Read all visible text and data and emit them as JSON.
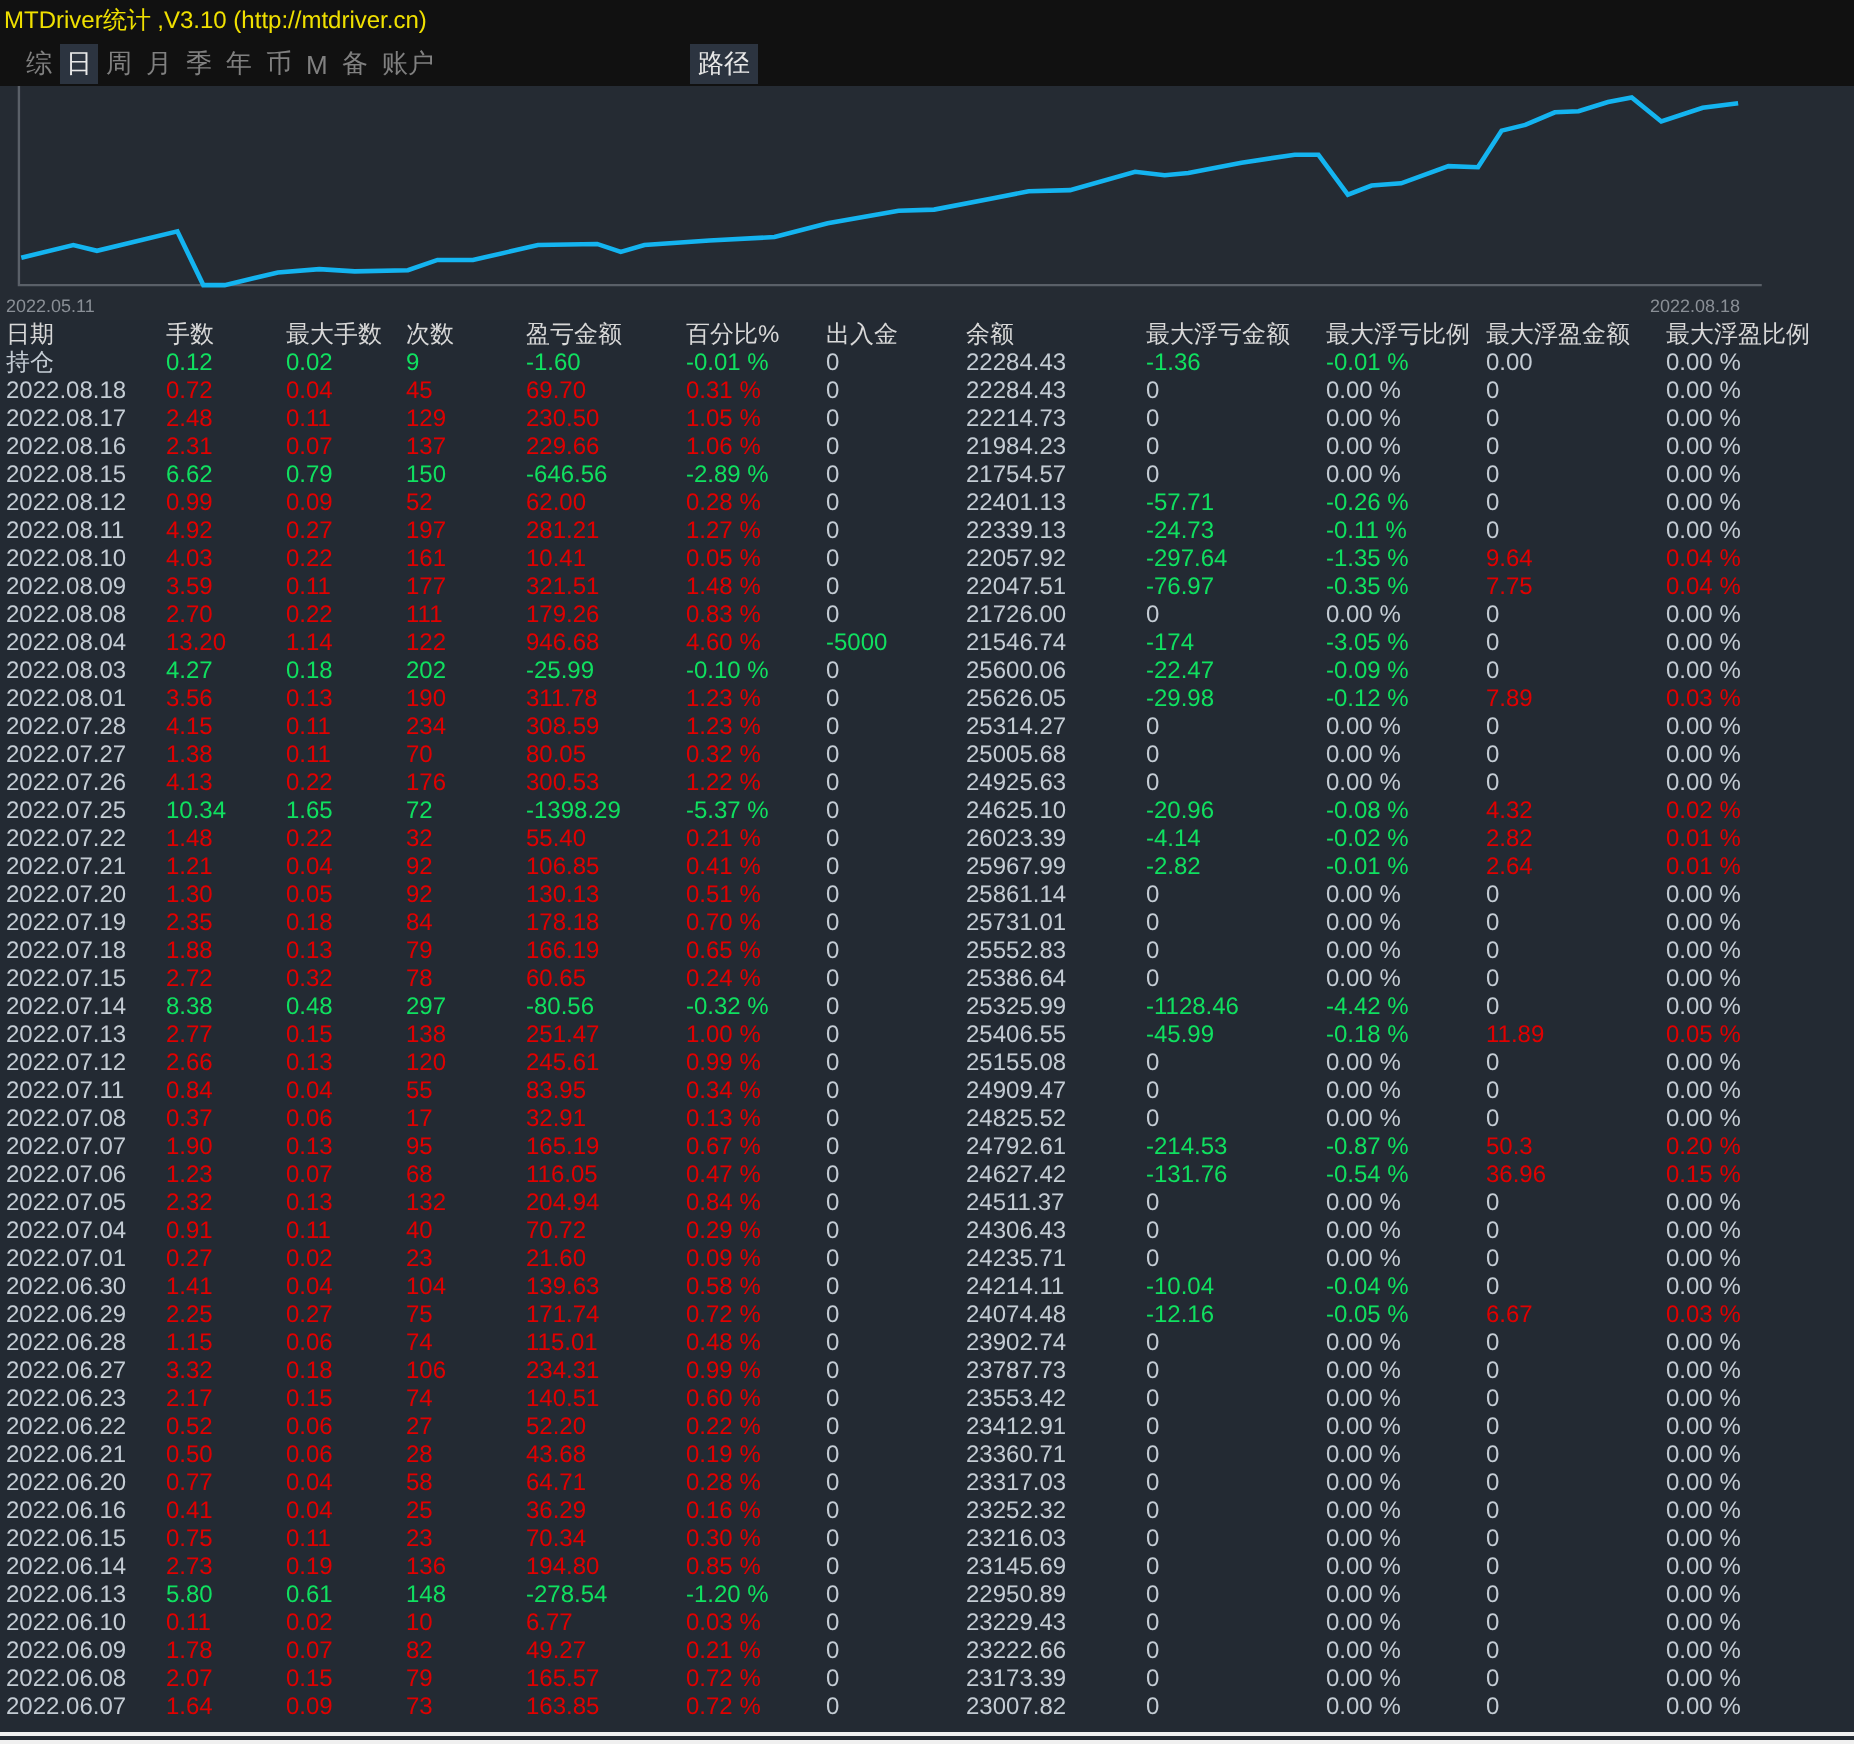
{
  "window": {
    "title": "MTDriver统计 ,V3.10 (http://mtdriver.cn)"
  },
  "tabs": [
    {
      "label": "综",
      "selected": false
    },
    {
      "label": "日",
      "selected": true
    },
    {
      "label": "周",
      "selected": false
    },
    {
      "label": "月",
      "selected": false
    },
    {
      "label": "季",
      "selected": false
    },
    {
      "label": "年",
      "selected": false
    },
    {
      "label": "币",
      "selected": false
    },
    {
      "label": "M",
      "selected": false
    },
    {
      "label": "备",
      "selected": false
    },
    {
      "label": "账户",
      "selected": false
    }
  ],
  "path_button": "路径",
  "chart": {
    "start_label": "2022.05.11",
    "end_label": "2022.08.18"
  },
  "table": {
    "columns": [
      "日期",
      "手数",
      "最大手数",
      "次数",
      "盈亏金额",
      "百分比%",
      "出入金",
      "余额",
      "最大浮亏金额",
      "最大浮亏比例",
      "最大浮盈金额",
      "最大浮盈比例"
    ],
    "rows": [
      {
        "cells": [
          "持仓",
          "0.12",
          "0.02",
          "9",
          "-1.60",
          "-0.01 %",
          "0",
          "22284.43",
          "-1.36",
          "-0.01 %",
          "0.00",
          "0.00 %"
        ],
        "loss": true,
        "cash_out": false,
        "drawdown": true,
        "runup": false
      },
      {
        "cells": [
          "2022.08.18",
          "0.72",
          "0.04",
          "45",
          "69.70",
          "0.31 %",
          "0",
          "22284.43",
          "0",
          "0.00 %",
          "0",
          "0.00 %"
        ],
        "loss": false,
        "cash_out": false,
        "drawdown": false,
        "runup": false
      },
      {
        "cells": [
          "2022.08.17",
          "2.48",
          "0.11",
          "129",
          "230.50",
          "1.05 %",
          "0",
          "22214.73",
          "0",
          "0.00 %",
          "0",
          "0.00 %"
        ],
        "loss": false,
        "cash_out": false,
        "drawdown": false,
        "runup": false
      },
      {
        "cells": [
          "2022.08.16",
          "2.31",
          "0.07",
          "137",
          "229.66",
          "1.06 %",
          "0",
          "21984.23",
          "0",
          "0.00 %",
          "0",
          "0.00 %"
        ],
        "loss": false,
        "cash_out": false,
        "drawdown": false,
        "runup": false
      },
      {
        "cells": [
          "2022.08.15",
          "6.62",
          "0.79",
          "150",
          "-646.56",
          "-2.89 %",
          "0",
          "21754.57",
          "0",
          "0.00 %",
          "0",
          "0.00 %"
        ],
        "loss": true,
        "cash_out": false,
        "drawdown": false,
        "runup": false
      },
      {
        "cells": [
          "2022.08.12",
          "0.99",
          "0.09",
          "52",
          "62.00",
          "0.28 %",
          "0",
          "22401.13",
          "-57.71",
          "-0.26 %",
          "0",
          "0.00 %"
        ],
        "loss": false,
        "cash_out": false,
        "drawdown": true,
        "runup": false
      },
      {
        "cells": [
          "2022.08.11",
          "4.92",
          "0.27",
          "197",
          "281.21",
          "1.27 %",
          "0",
          "22339.13",
          "-24.73",
          "-0.11 %",
          "0",
          "0.00 %"
        ],
        "loss": false,
        "cash_out": false,
        "drawdown": true,
        "runup": false
      },
      {
        "cells": [
          "2022.08.10",
          "4.03",
          "0.22",
          "161",
          "10.41",
          "0.05 %",
          "0",
          "22057.92",
          "-297.64",
          "-1.35 %",
          "9.64",
          "0.04 %"
        ],
        "loss": false,
        "cash_out": false,
        "drawdown": true,
        "runup": true
      },
      {
        "cells": [
          "2022.08.09",
          "3.59",
          "0.11",
          "177",
          "321.51",
          "1.48 %",
          "0",
          "22047.51",
          "-76.97",
          "-0.35 %",
          "7.75",
          "0.04 %"
        ],
        "loss": false,
        "cash_out": false,
        "drawdown": true,
        "runup": true
      },
      {
        "cells": [
          "2022.08.08",
          "2.70",
          "0.22",
          "111",
          "179.26",
          "0.83 %",
          "0",
          "21726.00",
          "0",
          "0.00 %",
          "0",
          "0.00 %"
        ],
        "loss": false,
        "cash_out": false,
        "drawdown": false,
        "runup": false
      },
      {
        "cells": [
          "2022.08.04",
          "13.20",
          "1.14",
          "122",
          "946.68",
          "4.60 %",
          "-5000",
          "21546.74",
          "-174",
          "-3.05 %",
          "0",
          "0.00 %"
        ],
        "loss": false,
        "cash_out": true,
        "drawdown": true,
        "runup": false
      },
      {
        "cells": [
          "2022.08.03",
          "4.27",
          "0.18",
          "202",
          "-25.99",
          "-0.10 %",
          "0",
          "25600.06",
          "-22.47",
          "-0.09 %",
          "0",
          "0.00 %"
        ],
        "loss": true,
        "cash_out": false,
        "drawdown": true,
        "runup": false
      },
      {
        "cells": [
          "2022.08.01",
          "3.56",
          "0.13",
          "190",
          "311.78",
          "1.23 %",
          "0",
          "25626.05",
          "-29.98",
          "-0.12 %",
          "7.89",
          "0.03 %"
        ],
        "loss": false,
        "cash_out": false,
        "drawdown": true,
        "runup": true
      },
      {
        "cells": [
          "2022.07.28",
          "4.15",
          "0.11",
          "234",
          "308.59",
          "1.23 %",
          "0",
          "25314.27",
          "0",
          "0.00 %",
          "0",
          "0.00 %"
        ],
        "loss": false,
        "cash_out": false,
        "drawdown": false,
        "runup": false
      },
      {
        "cells": [
          "2022.07.27",
          "1.38",
          "0.11",
          "70",
          "80.05",
          "0.32 %",
          "0",
          "25005.68",
          "0",
          "0.00 %",
          "0",
          "0.00 %"
        ],
        "loss": false,
        "cash_out": false,
        "drawdown": false,
        "runup": false
      },
      {
        "cells": [
          "2022.07.26",
          "4.13",
          "0.22",
          "176",
          "300.53",
          "1.22 %",
          "0",
          "24925.63",
          "0",
          "0.00 %",
          "0",
          "0.00 %"
        ],
        "loss": false,
        "cash_out": false,
        "drawdown": false,
        "runup": false
      },
      {
        "cells": [
          "2022.07.25",
          "10.34",
          "1.65",
          "72",
          "-1398.29",
          "-5.37 %",
          "0",
          "24625.10",
          "-20.96",
          "-0.08 %",
          "4.32",
          "0.02 %"
        ],
        "loss": true,
        "cash_out": false,
        "drawdown": true,
        "runup": true
      },
      {
        "cells": [
          "2022.07.22",
          "1.48",
          "0.22",
          "32",
          "55.40",
          "0.21 %",
          "0",
          "26023.39",
          "-4.14",
          "-0.02 %",
          "2.82",
          "0.01 %"
        ],
        "loss": false,
        "cash_out": false,
        "drawdown": true,
        "runup": true
      },
      {
        "cells": [
          "2022.07.21",
          "1.21",
          "0.04",
          "92",
          "106.85",
          "0.41 %",
          "0",
          "25967.99",
          "-2.82",
          "-0.01 %",
          "2.64",
          "0.01 %"
        ],
        "loss": false,
        "cash_out": false,
        "drawdown": true,
        "runup": true
      },
      {
        "cells": [
          "2022.07.20",
          "1.30",
          "0.05",
          "92",
          "130.13",
          "0.51 %",
          "0",
          "25861.14",
          "0",
          "0.00 %",
          "0",
          "0.00 %"
        ],
        "loss": false,
        "cash_out": false,
        "drawdown": false,
        "runup": false
      },
      {
        "cells": [
          "2022.07.19",
          "2.35",
          "0.18",
          "84",
          "178.18",
          "0.70 %",
          "0",
          "25731.01",
          "0",
          "0.00 %",
          "0",
          "0.00 %"
        ],
        "loss": false,
        "cash_out": false,
        "drawdown": false,
        "runup": false
      },
      {
        "cells": [
          "2022.07.18",
          "1.88",
          "0.13",
          "79",
          "166.19",
          "0.65 %",
          "0",
          "25552.83",
          "0",
          "0.00 %",
          "0",
          "0.00 %"
        ],
        "loss": false,
        "cash_out": false,
        "drawdown": false,
        "runup": false
      },
      {
        "cells": [
          "2022.07.15",
          "2.72",
          "0.32",
          "78",
          "60.65",
          "0.24 %",
          "0",
          "25386.64",
          "0",
          "0.00 %",
          "0",
          "0.00 %"
        ],
        "loss": false,
        "cash_out": false,
        "drawdown": false,
        "runup": false
      },
      {
        "cells": [
          "2022.07.14",
          "8.38",
          "0.48",
          "297",
          "-80.56",
          "-0.32 %",
          "0",
          "25325.99",
          "-1128.46",
          "-4.42 %",
          "0",
          "0.00 %"
        ],
        "loss": true,
        "cash_out": false,
        "drawdown": true,
        "runup": false
      },
      {
        "cells": [
          "2022.07.13",
          "2.77",
          "0.15",
          "138",
          "251.47",
          "1.00 %",
          "0",
          "25406.55",
          "-45.99",
          "-0.18 %",
          "11.89",
          "0.05 %"
        ],
        "loss": false,
        "cash_out": false,
        "drawdown": true,
        "runup": true
      },
      {
        "cells": [
          "2022.07.12",
          "2.66",
          "0.13",
          "120",
          "245.61",
          "0.99 %",
          "0",
          "25155.08",
          "0",
          "0.00 %",
          "0",
          "0.00 %"
        ],
        "loss": false,
        "cash_out": false,
        "drawdown": false,
        "runup": false
      },
      {
        "cells": [
          "2022.07.11",
          "0.84",
          "0.04",
          "55",
          "83.95",
          "0.34 %",
          "0",
          "24909.47",
          "0",
          "0.00 %",
          "0",
          "0.00 %"
        ],
        "loss": false,
        "cash_out": false,
        "drawdown": false,
        "runup": false
      },
      {
        "cells": [
          "2022.07.08",
          "0.37",
          "0.06",
          "17",
          "32.91",
          "0.13 %",
          "0",
          "24825.52",
          "0",
          "0.00 %",
          "0",
          "0.00 %"
        ],
        "loss": false,
        "cash_out": false,
        "drawdown": false,
        "runup": false
      },
      {
        "cells": [
          "2022.07.07",
          "1.90",
          "0.13",
          "95",
          "165.19",
          "0.67 %",
          "0",
          "24792.61",
          "-214.53",
          "-0.87 %",
          "50.3",
          "0.20 %"
        ],
        "loss": false,
        "cash_out": false,
        "drawdown": true,
        "runup": true
      },
      {
        "cells": [
          "2022.07.06",
          "1.23",
          "0.07",
          "68",
          "116.05",
          "0.47 %",
          "0",
          "24627.42",
          "-131.76",
          "-0.54 %",
          "36.96",
          "0.15 %"
        ],
        "loss": false,
        "cash_out": false,
        "drawdown": true,
        "runup": true
      },
      {
        "cells": [
          "2022.07.05",
          "2.32",
          "0.13",
          "132",
          "204.94",
          "0.84 %",
          "0",
          "24511.37",
          "0",
          "0.00 %",
          "0",
          "0.00 %"
        ],
        "loss": false,
        "cash_out": false,
        "drawdown": false,
        "runup": false
      },
      {
        "cells": [
          "2022.07.04",
          "0.91",
          "0.11",
          "40",
          "70.72",
          "0.29 %",
          "0",
          "24306.43",
          "0",
          "0.00 %",
          "0",
          "0.00 %"
        ],
        "loss": false,
        "cash_out": false,
        "drawdown": false,
        "runup": false
      },
      {
        "cells": [
          "2022.07.01",
          "0.27",
          "0.02",
          "23",
          "21.60",
          "0.09 %",
          "0",
          "24235.71",
          "0",
          "0.00 %",
          "0",
          "0.00 %"
        ],
        "loss": false,
        "cash_out": false,
        "drawdown": false,
        "runup": false
      },
      {
        "cells": [
          "2022.06.30",
          "1.41",
          "0.04",
          "104",
          "139.63",
          "0.58 %",
          "0",
          "24214.11",
          "-10.04",
          "-0.04 %",
          "0",
          "0.00 %"
        ],
        "loss": false,
        "cash_out": false,
        "drawdown": true,
        "runup": false
      },
      {
        "cells": [
          "2022.06.29",
          "2.25",
          "0.27",
          "75",
          "171.74",
          "0.72 %",
          "0",
          "24074.48",
          "-12.16",
          "-0.05 %",
          "6.67",
          "0.03 %"
        ],
        "loss": false,
        "cash_out": false,
        "drawdown": true,
        "runup": true
      },
      {
        "cells": [
          "2022.06.28",
          "1.15",
          "0.06",
          "74",
          "115.01",
          "0.48 %",
          "0",
          "23902.74",
          "0",
          "0.00 %",
          "0",
          "0.00 %"
        ],
        "loss": false,
        "cash_out": false,
        "drawdown": false,
        "runup": false
      },
      {
        "cells": [
          "2022.06.27",
          "3.32",
          "0.18",
          "106",
          "234.31",
          "0.99 %",
          "0",
          "23787.73",
          "0",
          "0.00 %",
          "0",
          "0.00 %"
        ],
        "loss": false,
        "cash_out": false,
        "drawdown": false,
        "runup": false
      },
      {
        "cells": [
          "2022.06.23",
          "2.17",
          "0.15",
          "74",
          "140.51",
          "0.60 %",
          "0",
          "23553.42",
          "0",
          "0.00 %",
          "0",
          "0.00 %"
        ],
        "loss": false,
        "cash_out": false,
        "drawdown": false,
        "runup": false
      },
      {
        "cells": [
          "2022.06.22",
          "0.52",
          "0.06",
          "27",
          "52.20",
          "0.22 %",
          "0",
          "23412.91",
          "0",
          "0.00 %",
          "0",
          "0.00 %"
        ],
        "loss": false,
        "cash_out": false,
        "drawdown": false,
        "runup": false
      },
      {
        "cells": [
          "2022.06.21",
          "0.50",
          "0.06",
          "28",
          "43.68",
          "0.19 %",
          "0",
          "23360.71",
          "0",
          "0.00 %",
          "0",
          "0.00 %"
        ],
        "loss": false,
        "cash_out": false,
        "drawdown": false,
        "runup": false
      },
      {
        "cells": [
          "2022.06.20",
          "0.77",
          "0.04",
          "58",
          "64.71",
          "0.28 %",
          "0",
          "23317.03",
          "0",
          "0.00 %",
          "0",
          "0.00 %"
        ],
        "loss": false,
        "cash_out": false,
        "drawdown": false,
        "runup": false
      },
      {
        "cells": [
          "2022.06.16",
          "0.41",
          "0.04",
          "25",
          "36.29",
          "0.16 %",
          "0",
          "23252.32",
          "0",
          "0.00 %",
          "0",
          "0.00 %"
        ],
        "loss": false,
        "cash_out": false,
        "drawdown": false,
        "runup": false
      },
      {
        "cells": [
          "2022.06.15",
          "0.75",
          "0.11",
          "23",
          "70.34",
          "0.30 %",
          "0",
          "23216.03",
          "0",
          "0.00 %",
          "0",
          "0.00 %"
        ],
        "loss": false,
        "cash_out": false,
        "drawdown": false,
        "runup": false
      },
      {
        "cells": [
          "2022.06.14",
          "2.73",
          "0.19",
          "136",
          "194.80",
          "0.85 %",
          "0",
          "23145.69",
          "0",
          "0.00 %",
          "0",
          "0.00 %"
        ],
        "loss": false,
        "cash_out": false,
        "drawdown": false,
        "runup": false
      },
      {
        "cells": [
          "2022.06.13",
          "5.80",
          "0.61",
          "148",
          "-278.54",
          "-1.20 %",
          "0",
          "22950.89",
          "0",
          "0.00 %",
          "0",
          "0.00 %"
        ],
        "loss": true,
        "cash_out": false,
        "drawdown": false,
        "runup": false
      },
      {
        "cells": [
          "2022.06.10",
          "0.11",
          "0.02",
          "10",
          "6.77",
          "0.03 %",
          "0",
          "23229.43",
          "0",
          "0.00 %",
          "0",
          "0.00 %"
        ],
        "loss": false,
        "cash_out": false,
        "drawdown": false,
        "runup": false
      },
      {
        "cells": [
          "2022.06.09",
          "1.78",
          "0.07",
          "82",
          "49.27",
          "0.21 %",
          "0",
          "23222.66",
          "0",
          "0.00 %",
          "0",
          "0.00 %"
        ],
        "loss": false,
        "cash_out": false,
        "drawdown": false,
        "runup": false
      },
      {
        "cells": [
          "2022.06.08",
          "2.07",
          "0.15",
          "79",
          "165.57",
          "0.72 %",
          "0",
          "23173.39",
          "0",
          "0.00 %",
          "0",
          "0.00 %"
        ],
        "loss": false,
        "cash_out": false,
        "drawdown": false,
        "runup": false
      },
      {
        "cells": [
          "2022.06.07",
          "1.64",
          "0.09",
          "73",
          "163.85",
          "0.72 %",
          "0",
          "23007.82",
          "0",
          "0.00 %",
          "0",
          "0.00 %"
        ],
        "loss": false,
        "cash_out": false,
        "drawdown": false,
        "runup": false
      }
    ]
  }
}
